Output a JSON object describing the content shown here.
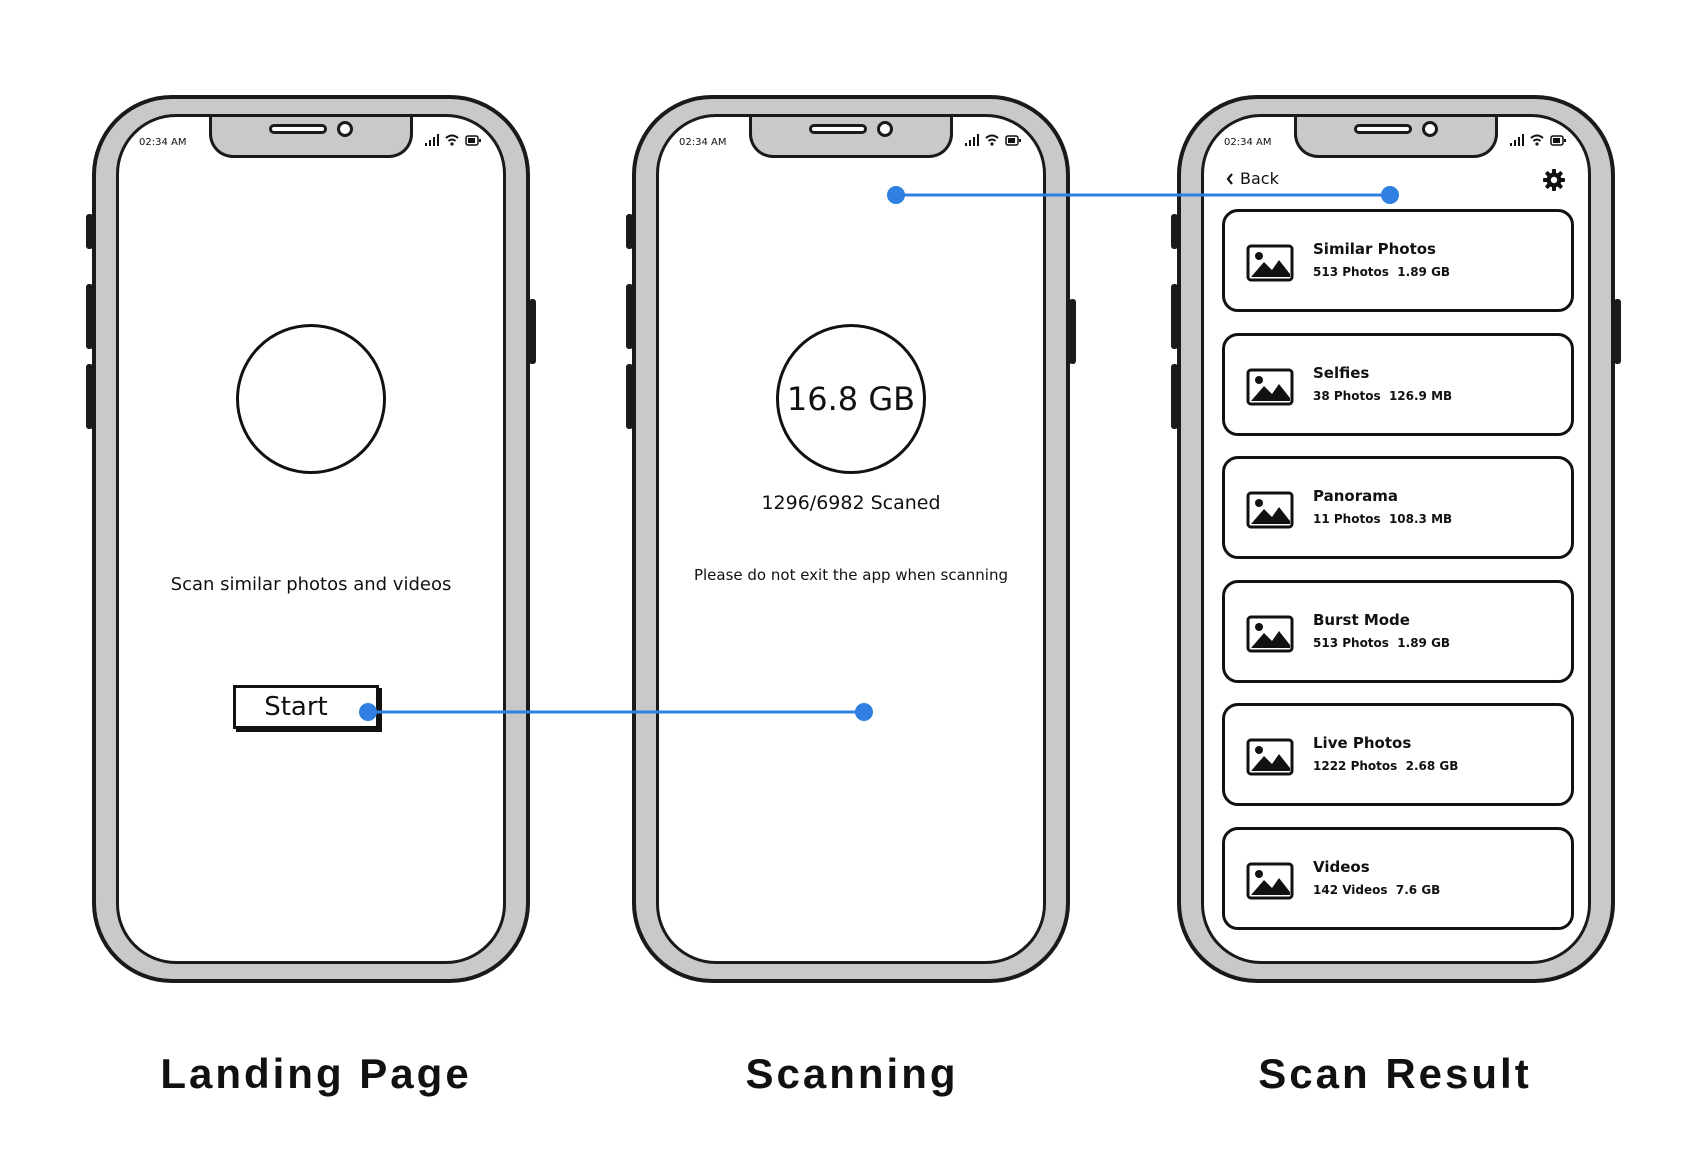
{
  "status_bar": {
    "time": "02:34 AM"
  },
  "screens": {
    "landing": {
      "caption": "Landing Page",
      "message": "Scan similar photos and videos",
      "start_label": "Start"
    },
    "scanning": {
      "caption": "Scanning",
      "size": "16.8 GB",
      "progress": "1296/6982 Scaned",
      "warning": "Please do not exit the app when scanning"
    },
    "result": {
      "caption": "Scan Result",
      "back_label": "Back",
      "categories": [
        {
          "name": "Similar Photos",
          "count": "513 Photos",
          "size": "1.89 GB"
        },
        {
          "name": "Selfies",
          "count": "38 Photos",
          "size": "126.9 MB"
        },
        {
          "name": "Panorama",
          "count": "11 Photos",
          "size": "108.3 MB"
        },
        {
          "name": "Burst Mode",
          "count": "513 Photos",
          "size": "1.89 GB"
        },
        {
          "name": "Live Photos",
          "count": "1222 Photos",
          "size": "2.68 GB"
        },
        {
          "name": "Videos",
          "count": "142 Videos",
          "size": "7.6 GB"
        }
      ]
    }
  },
  "colors": {
    "connector": "#2f80e0",
    "frame": "#c9c9c9",
    "ink": "#1a1a1a"
  }
}
